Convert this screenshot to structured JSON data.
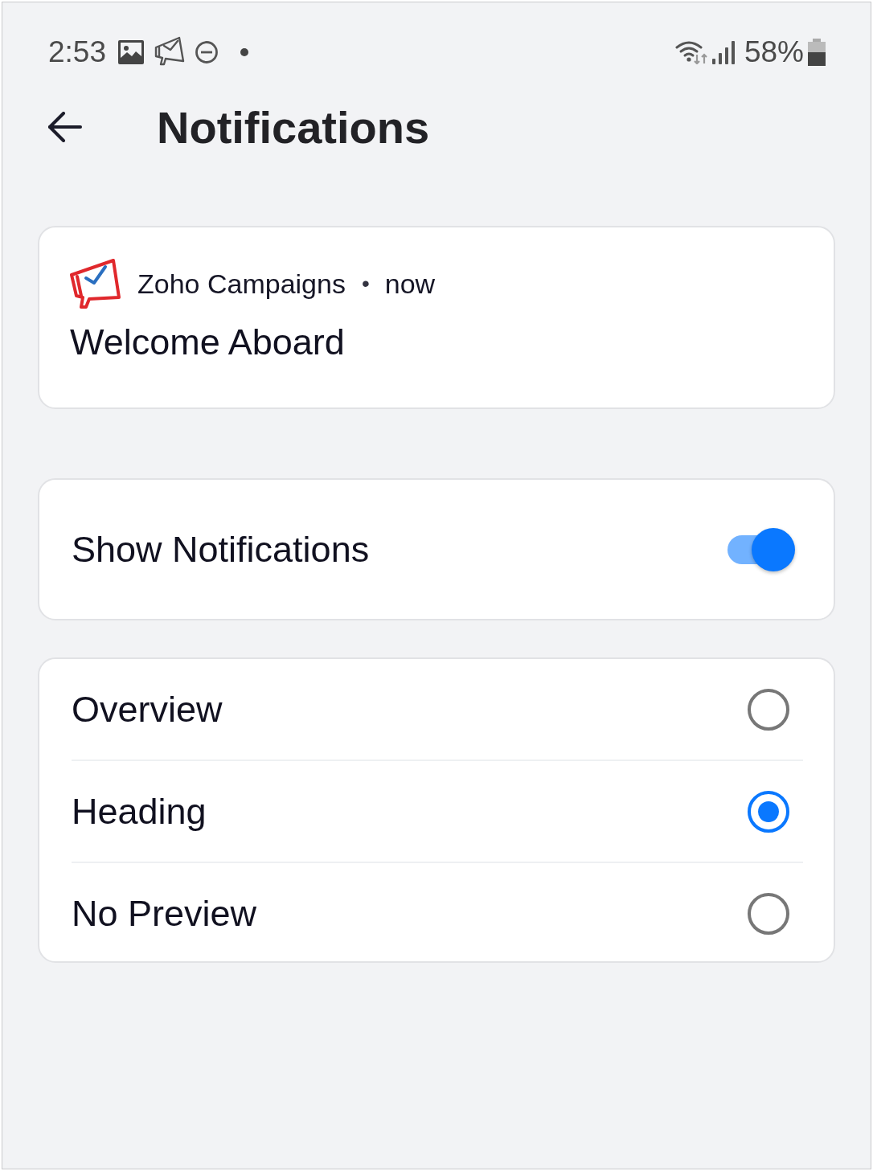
{
  "status_bar": {
    "time": "2:53",
    "battery": "58%"
  },
  "header": {
    "title": "Notifications"
  },
  "notification": {
    "app": "Zoho Campaigns",
    "separator": "•",
    "time": "now",
    "title": "Welcome Aboard"
  },
  "settings": {
    "show_notifications": {
      "label": "Show Notifications",
      "on": true
    }
  },
  "preview_options": [
    {
      "label": "Overview",
      "selected": false
    },
    {
      "label": "Heading",
      "selected": true
    },
    {
      "label": "No Preview",
      "selected": false
    }
  ]
}
